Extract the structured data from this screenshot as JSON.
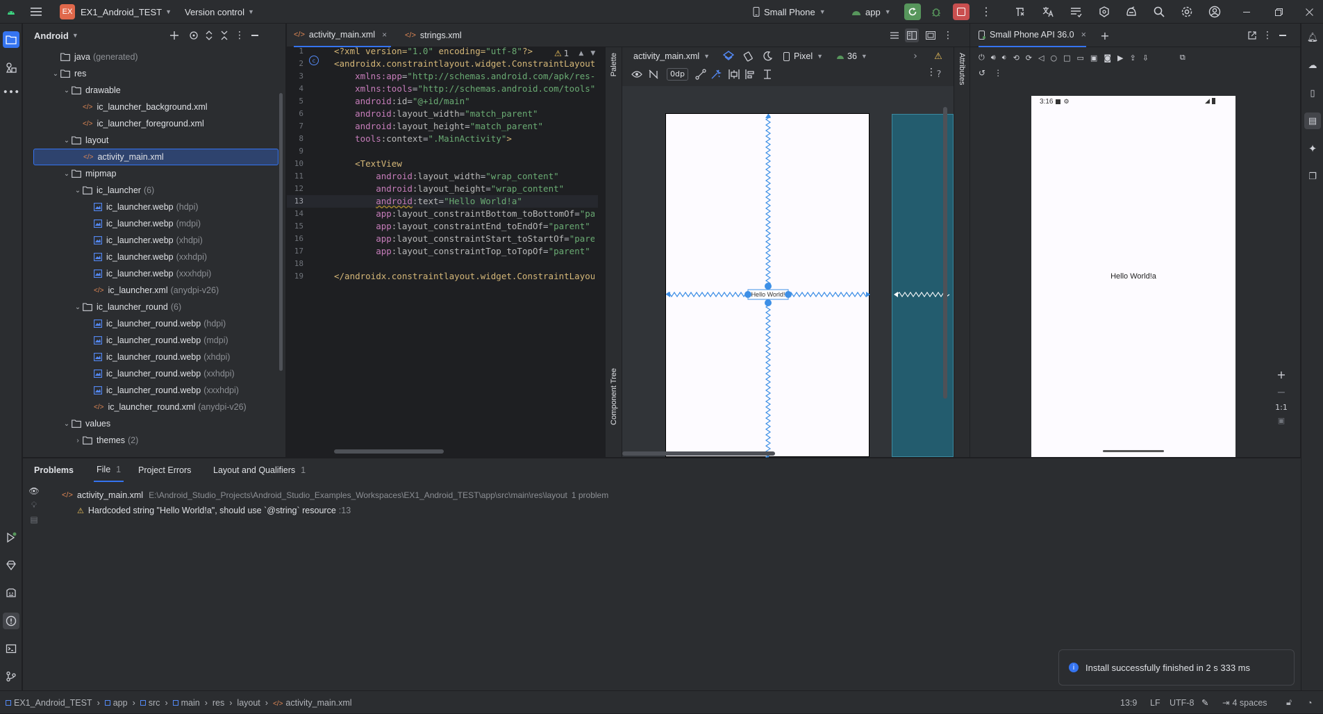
{
  "titlebar": {
    "project_badge": "EX",
    "project_name": "EX1_Android_TEST",
    "version_control": "Version control",
    "device": "Small Phone",
    "run_config": "app",
    "colors": {
      "run_green": "#57965c",
      "stop_red": "#c94f4f",
      "badge_orange": "#e0684b"
    }
  },
  "project_panel": {
    "view": "Android",
    "tree": [
      {
        "label": "java",
        "hint": "(generated)",
        "type": "folder",
        "indent": 0,
        "arrow": ""
      },
      {
        "label": "res",
        "hint": "",
        "type": "folder",
        "indent": 0,
        "arrow": "down"
      },
      {
        "label": "drawable",
        "hint": "",
        "type": "folder",
        "indent": 1,
        "arrow": "down"
      },
      {
        "label": "ic_launcher_background.xml",
        "hint": "",
        "type": "xml",
        "indent": 2,
        "arrow": ""
      },
      {
        "label": "ic_launcher_foreground.xml",
        "hint": "",
        "type": "xml",
        "indent": 2,
        "arrow": ""
      },
      {
        "label": "layout",
        "hint": "",
        "type": "folder",
        "indent": 1,
        "arrow": "down"
      },
      {
        "label": "activity_main.xml",
        "hint": "",
        "type": "xml",
        "indent": 2,
        "arrow": "",
        "selected": true
      },
      {
        "label": "mipmap",
        "hint": "",
        "type": "folder",
        "indent": 1,
        "arrow": "down"
      },
      {
        "label": "ic_launcher",
        "hint": "(6)",
        "type": "folder",
        "indent": 2,
        "arrow": "down"
      },
      {
        "label": "ic_launcher.webp",
        "hint": "(hdpi)",
        "type": "img",
        "indent": 3,
        "arrow": ""
      },
      {
        "label": "ic_launcher.webp",
        "hint": "(mdpi)",
        "type": "img",
        "indent": 3,
        "arrow": ""
      },
      {
        "label": "ic_launcher.webp",
        "hint": "(xhdpi)",
        "type": "img",
        "indent": 3,
        "arrow": ""
      },
      {
        "label": "ic_launcher.webp",
        "hint": "(xxhdpi)",
        "type": "img",
        "indent": 3,
        "arrow": ""
      },
      {
        "label": "ic_launcher.webp",
        "hint": "(xxxhdpi)",
        "type": "img",
        "indent": 3,
        "arrow": ""
      },
      {
        "label": "ic_launcher.xml",
        "hint": "(anydpi-v26)",
        "type": "xml",
        "indent": 3,
        "arrow": ""
      },
      {
        "label": "ic_launcher_round",
        "hint": "(6)",
        "type": "folder",
        "indent": 2,
        "arrow": "down"
      },
      {
        "label": "ic_launcher_round.webp",
        "hint": "(hdpi)",
        "type": "img",
        "indent": 3,
        "arrow": ""
      },
      {
        "label": "ic_launcher_round.webp",
        "hint": "(mdpi)",
        "type": "img",
        "indent": 3,
        "arrow": ""
      },
      {
        "label": "ic_launcher_round.webp",
        "hint": "(xhdpi)",
        "type": "img",
        "indent": 3,
        "arrow": ""
      },
      {
        "label": "ic_launcher_round.webp",
        "hint": "(xxhdpi)",
        "type": "img",
        "indent": 3,
        "arrow": ""
      },
      {
        "label": "ic_launcher_round.webp",
        "hint": "(xxxhdpi)",
        "type": "img",
        "indent": 3,
        "arrow": ""
      },
      {
        "label": "ic_launcher_round.xml",
        "hint": "(anydpi-v26)",
        "type": "xml",
        "indent": 3,
        "arrow": ""
      },
      {
        "label": "values",
        "hint": "",
        "type": "folder",
        "indent": 1,
        "arrow": "down"
      },
      {
        "label": "themes",
        "hint": "(2)",
        "type": "folder",
        "indent": 2,
        "arrow": "right"
      }
    ]
  },
  "editor": {
    "tabs": [
      {
        "label": "activity_main.xml",
        "active": true
      },
      {
        "label": "strings.xml",
        "active": false
      }
    ],
    "warning_count": "1",
    "current_line": 13,
    "lines": [
      [
        [
          "tag",
          "<?xml version="
        ],
        [
          "str",
          "\"1.0\""
        ],
        [
          "tag",
          " encoding="
        ],
        [
          "str",
          "\"utf-8\""
        ],
        [
          "tag",
          "?>"
        ]
      ],
      [
        [
          "tag",
          "<androidx.constraintlayout.widget.ConstraintLayout"
        ]
      ],
      [
        [
          "plain",
          "    "
        ],
        [
          "attr-ns",
          "xmlns:app"
        ],
        [
          "plain",
          "="
        ],
        [
          "str",
          "\"http://schemas.android.com/apk/res-auto\""
        ]
      ],
      [
        [
          "plain",
          "    "
        ],
        [
          "attr-ns",
          "xmlns:tools"
        ],
        [
          "plain",
          "="
        ],
        [
          "str",
          "\"http://schemas.android.com/tools\""
        ]
      ],
      [
        [
          "plain",
          "    "
        ],
        [
          "attr-ns",
          "android"
        ],
        [
          "attr",
          ":id"
        ],
        [
          "plain",
          "="
        ],
        [
          "str",
          "\"@+id/main\""
        ]
      ],
      [
        [
          "plain",
          "    "
        ],
        [
          "attr-ns",
          "android"
        ],
        [
          "attr",
          ":layout_width"
        ],
        [
          "plain",
          "="
        ],
        [
          "str",
          "\"match_parent\""
        ]
      ],
      [
        [
          "plain",
          "    "
        ],
        [
          "attr-ns",
          "android"
        ],
        [
          "attr",
          ":layout_height"
        ],
        [
          "plain",
          "="
        ],
        [
          "str",
          "\"match_parent\""
        ]
      ],
      [
        [
          "plain",
          "    "
        ],
        [
          "attr-ns",
          "tools"
        ],
        [
          "attr",
          ":context"
        ],
        [
          "plain",
          "="
        ],
        [
          "str",
          "\".MainActivity\""
        ],
        [
          "tag",
          ">"
        ]
      ],
      [],
      [
        [
          "plain",
          "    "
        ],
        [
          "tag",
          "<TextView"
        ]
      ],
      [
        [
          "plain",
          "        "
        ],
        [
          "attr-ns",
          "android"
        ],
        [
          "attr",
          ":layout_width"
        ],
        [
          "plain",
          "="
        ],
        [
          "str",
          "\"wrap_content\""
        ]
      ],
      [
        [
          "plain",
          "        "
        ],
        [
          "attr-ns",
          "android"
        ],
        [
          "attr",
          ":layout_height"
        ],
        [
          "plain",
          "="
        ],
        [
          "str",
          "\"wrap_content\""
        ]
      ],
      [
        [
          "plain",
          "        "
        ],
        [
          "attr-ns",
          "android"
        ],
        [
          "attr",
          ":text"
        ],
        [
          "plain",
          "="
        ],
        [
          "str",
          "\"Hello World!a\""
        ]
      ],
      [
        [
          "plain",
          "        "
        ],
        [
          "attr-ns",
          "app"
        ],
        [
          "attr",
          ":layout_constraintBottom_toBottomOf"
        ],
        [
          "plain",
          "="
        ],
        [
          "str",
          "\"parent\""
        ]
      ],
      [
        [
          "plain",
          "        "
        ],
        [
          "attr-ns",
          "app"
        ],
        [
          "attr",
          ":layout_constraintEnd_toEndOf"
        ],
        [
          "plain",
          "="
        ],
        [
          "str",
          "\"parent\""
        ]
      ],
      [
        [
          "plain",
          "        "
        ],
        [
          "attr-ns",
          "app"
        ],
        [
          "attr",
          ":layout_constraintStart_toStartOf"
        ],
        [
          "plain",
          "="
        ],
        [
          "str",
          "\"parent\""
        ]
      ],
      [
        [
          "plain",
          "        "
        ],
        [
          "attr-ns",
          "app"
        ],
        [
          "attr",
          ":layout_constraintTop_toTopOf"
        ],
        [
          "plain",
          "="
        ],
        [
          "str",
          "\"parent\""
        ],
        [
          "tag",
          " />"
        ]
      ],
      [],
      [
        [
          "tag",
          "</androidx.constraintlayout.widget.ConstraintLayout>"
        ]
      ]
    ]
  },
  "design": {
    "file": "activity_main.xml",
    "device": "Pixel",
    "api": "36",
    "margin": "0dp",
    "palette_label": "Palette",
    "component_tree_label": "Component Tree",
    "attributes_label": "Attributes",
    "preview_text": "Hello World!"
  },
  "device_panel": {
    "tab": "Small Phone API 36.0",
    "time": "3:16",
    "screen_text": "Hello World!a",
    "zoom_label": "1:1"
  },
  "problems": {
    "tabs": [
      {
        "label": "Problems",
        "count": ""
      },
      {
        "label": "File",
        "count": "1"
      },
      {
        "label": "Project Errors",
        "count": ""
      },
      {
        "label": "Layout and Qualifiers",
        "count": "1"
      }
    ],
    "file": "activity_main.xml",
    "path": "E:\\Android_Studio_Projects\\Android_Studio_Examples_Workspaces\\EX1_Android_TEST\\app\\src\\main\\res\\layout",
    "summary": "1 problem",
    "issue": "Hardcoded string \"Hello World!a\", should use `@string` resource",
    "issue_line": ":13"
  },
  "statusbar": {
    "crumbs": [
      "EX1_Android_TEST",
      "app",
      "src",
      "main",
      "res",
      "layout",
      "activity_main.xml"
    ],
    "position": "13:9",
    "line_sep": "LF",
    "encoding": "UTF-8",
    "indent": "4 spaces"
  },
  "toast": {
    "message": "Install successfully finished in 2 s 333 ms"
  }
}
